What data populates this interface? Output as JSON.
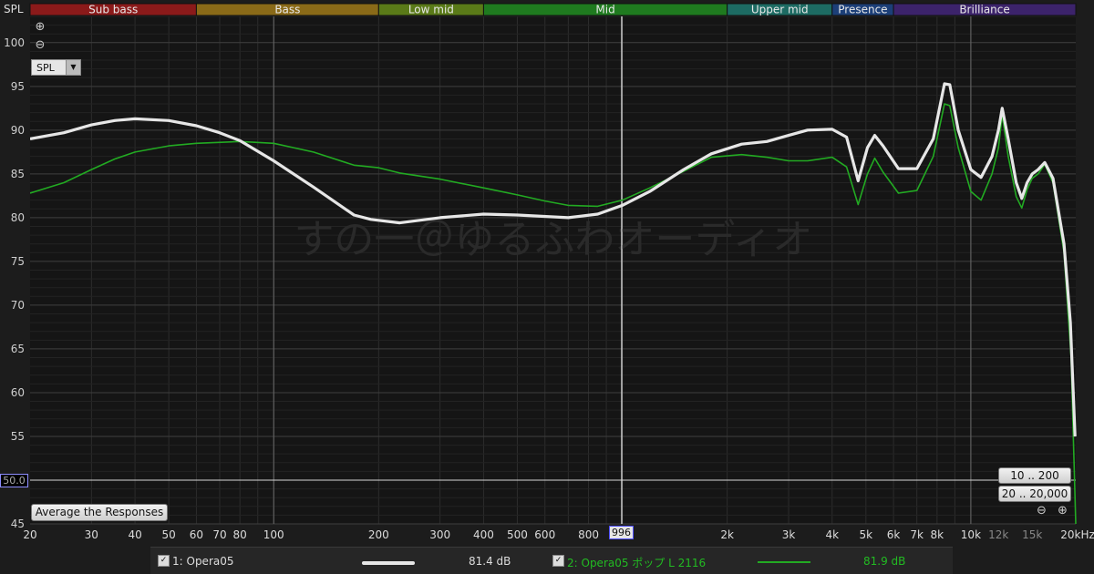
{
  "bands": [
    {
      "label": "Sub bass",
      "from": 20,
      "to": 60,
      "color": "#8b1a1a"
    },
    {
      "label": "Bass",
      "from": 60,
      "to": 200,
      "color": "#8a6a18"
    },
    {
      "label": "Low mid",
      "from": 200,
      "to": 400,
      "color": "#5a7a18"
    },
    {
      "label": "Mid",
      "from": 400,
      "to": 2000,
      "color": "#1f7a1f"
    },
    {
      "label": "Upper mid",
      "from": 2000,
      "to": 4000,
      "color": "#1d6b63"
    },
    {
      "label": "Presence",
      "from": 4000,
      "to": 6000,
      "color": "#1c3f78"
    },
    {
      "label": "Brilliance",
      "from": 6000,
      "to": 20000,
      "color": "#3c236b"
    }
  ],
  "ui": {
    "axis_name": "SPL",
    "zoom_in": "⊕",
    "zoom_out": "⊖",
    "mode_select": "SPL",
    "average_button": "Average the Responses",
    "range_button_1": "10 .. 200",
    "range_button_2": "20 .. 20,000",
    "reference_level": "50.0",
    "cursor_freq": "996",
    "watermark": "すの一＠ゆるふわオーディオ"
  },
  "legend": [
    {
      "checked": "✓",
      "name": "1: Opera05",
      "db": "81.4 dB",
      "color": "#e6e6e6",
      "text_color": "#dddddd"
    },
    {
      "checked": "✓",
      "name": "2: Opera05 ポップ L 2116",
      "db": "81.9 dB",
      "color": "#22aa22",
      "text_color": "#22bb22"
    }
  ],
  "chart_data": {
    "type": "line",
    "xscale": "log",
    "xlim": [
      20,
      20000
    ],
    "ylim": [
      45,
      103
    ],
    "xlabel": "",
    "ylabel": "SPL",
    "cursor_x": 996,
    "reference_y": 50,
    "y_ticks": [
      45,
      50,
      55,
      60,
      65,
      70,
      75,
      80,
      85,
      90,
      95,
      100
    ],
    "x_ticks": [
      {
        "v": 20,
        "l": "20"
      },
      {
        "v": 30,
        "l": "30"
      },
      {
        "v": 40,
        "l": "40"
      },
      {
        "v": 50,
        "l": "50"
      },
      {
        "v": 60,
        "l": "60"
      },
      {
        "v": 70,
        "l": "70"
      },
      {
        "v": 80,
        "l": "80"
      },
      {
        "v": 100,
        "l": "100"
      },
      {
        "v": 200,
        "l": "200"
      },
      {
        "v": 300,
        "l": "300"
      },
      {
        "v": 400,
        "l": "400"
      },
      {
        "v": 500,
        "l": "500"
      },
      {
        "v": 600,
        "l": "600"
      },
      {
        "v": 800,
        "l": "800"
      },
      {
        "v": 2000,
        "l": "2k"
      },
      {
        "v": 3000,
        "l": "3k"
      },
      {
        "v": 4000,
        "l": "4k"
      },
      {
        "v": 5000,
        "l": "5k"
      },
      {
        "v": 6000,
        "l": "6k"
      },
      {
        "v": 7000,
        "l": "7k"
      },
      {
        "v": 8000,
        "l": "8k"
      },
      {
        "v": 10000,
        "l": "10k"
      },
      {
        "v": 12000,
        "l": "12k"
      },
      {
        "v": 15000,
        "l": "15k"
      },
      {
        "v": 20000,
        "l": "20kHz"
      }
    ],
    "series": [
      {
        "name": "1: Opera05",
        "color": "#e6e6e6",
        "width": 3.2,
        "points": [
          [
            20,
            89
          ],
          [
            25,
            89.7
          ],
          [
            30,
            90.6
          ],
          [
            35,
            91.1
          ],
          [
            40,
            91.3
          ],
          [
            50,
            91.1
          ],
          [
            60,
            90.5
          ],
          [
            70,
            89.7
          ],
          [
            80,
            88.8
          ],
          [
            100,
            86.5
          ],
          [
            130,
            83.5
          ],
          [
            170,
            80.3
          ],
          [
            190,
            79.8
          ],
          [
            230,
            79.4
          ],
          [
            300,
            80
          ],
          [
            400,
            80.4
          ],
          [
            500,
            80.3
          ],
          [
            700,
            80
          ],
          [
            850,
            80.4
          ],
          [
            1000,
            81.4
          ],
          [
            1200,
            83
          ],
          [
            1500,
            85.5
          ],
          [
            1800,
            87.3
          ],
          [
            2200,
            88.4
          ],
          [
            2600,
            88.7
          ],
          [
            3000,
            89.4
          ],
          [
            3400,
            90
          ],
          [
            4000,
            90.1
          ],
          [
            4400,
            89.2
          ],
          [
            4750,
            84.2
          ],
          [
            5050,
            88
          ],
          [
            5300,
            89.4
          ],
          [
            5600,
            88.2
          ],
          [
            6200,
            85.6
          ],
          [
            7000,
            85.6
          ],
          [
            7800,
            89
          ],
          [
            8400,
            95.3
          ],
          [
            8700,
            95.2
          ],
          [
            9200,
            90
          ],
          [
            10000,
            85.5
          ],
          [
            10700,
            84.6
          ],
          [
            11500,
            87
          ],
          [
            12000,
            90
          ],
          [
            12300,
            92.5
          ],
          [
            12800,
            89
          ],
          [
            13500,
            84
          ],
          [
            14000,
            82.2
          ],
          [
            14500,
            84
          ],
          [
            15000,
            85
          ],
          [
            15600,
            85.5
          ],
          [
            16300,
            86.3
          ],
          [
            17200,
            84.5
          ],
          [
            18500,
            77
          ],
          [
            19300,
            68
          ],
          [
            19900,
            55
          ]
        ]
      },
      {
        "name": "2: Opera05 ポップ L 2116",
        "color": "#22aa22",
        "width": 1.6,
        "points": [
          [
            20,
            82.8
          ],
          [
            25,
            84
          ],
          [
            30,
            85.5
          ],
          [
            35,
            86.7
          ],
          [
            40,
            87.5
          ],
          [
            50,
            88.2
          ],
          [
            60,
            88.5
          ],
          [
            80,
            88.7
          ],
          [
            100,
            88.5
          ],
          [
            130,
            87.5
          ],
          [
            170,
            86
          ],
          [
            200,
            85.7
          ],
          [
            230,
            85.1
          ],
          [
            300,
            84.4
          ],
          [
            400,
            83.4
          ],
          [
            500,
            82.6
          ],
          [
            600,
            81.9
          ],
          [
            700,
            81.4
          ],
          [
            850,
            81.3
          ],
          [
            1000,
            82
          ],
          [
            1200,
            83.4
          ],
          [
            1500,
            85.3
          ],
          [
            1800,
            86.9
          ],
          [
            2200,
            87.2
          ],
          [
            2600,
            86.9
          ],
          [
            3000,
            86.5
          ],
          [
            3400,
            86.5
          ],
          [
            4000,
            86.9
          ],
          [
            4400,
            85.8
          ],
          [
            4750,
            81.5
          ],
          [
            5050,
            85
          ],
          [
            5300,
            86.8
          ],
          [
            5600,
            85.2
          ],
          [
            6200,
            82.8
          ],
          [
            7000,
            83.1
          ],
          [
            7800,
            87
          ],
          [
            8400,
            93
          ],
          [
            8700,
            92.8
          ],
          [
            9200,
            88
          ],
          [
            10000,
            83
          ],
          [
            10700,
            82
          ],
          [
            11500,
            85
          ],
          [
            12000,
            88
          ],
          [
            12300,
            91.8
          ],
          [
            12800,
            87
          ],
          [
            13500,
            82.4
          ],
          [
            14000,
            81.1
          ],
          [
            14500,
            83.2
          ],
          [
            15000,
            84.5
          ],
          [
            15600,
            85
          ],
          [
            16300,
            86.1
          ],
          [
            17200,
            84
          ],
          [
            18500,
            76
          ],
          [
            19400,
            64
          ],
          [
            20000,
            45
          ]
        ]
      }
    ]
  }
}
